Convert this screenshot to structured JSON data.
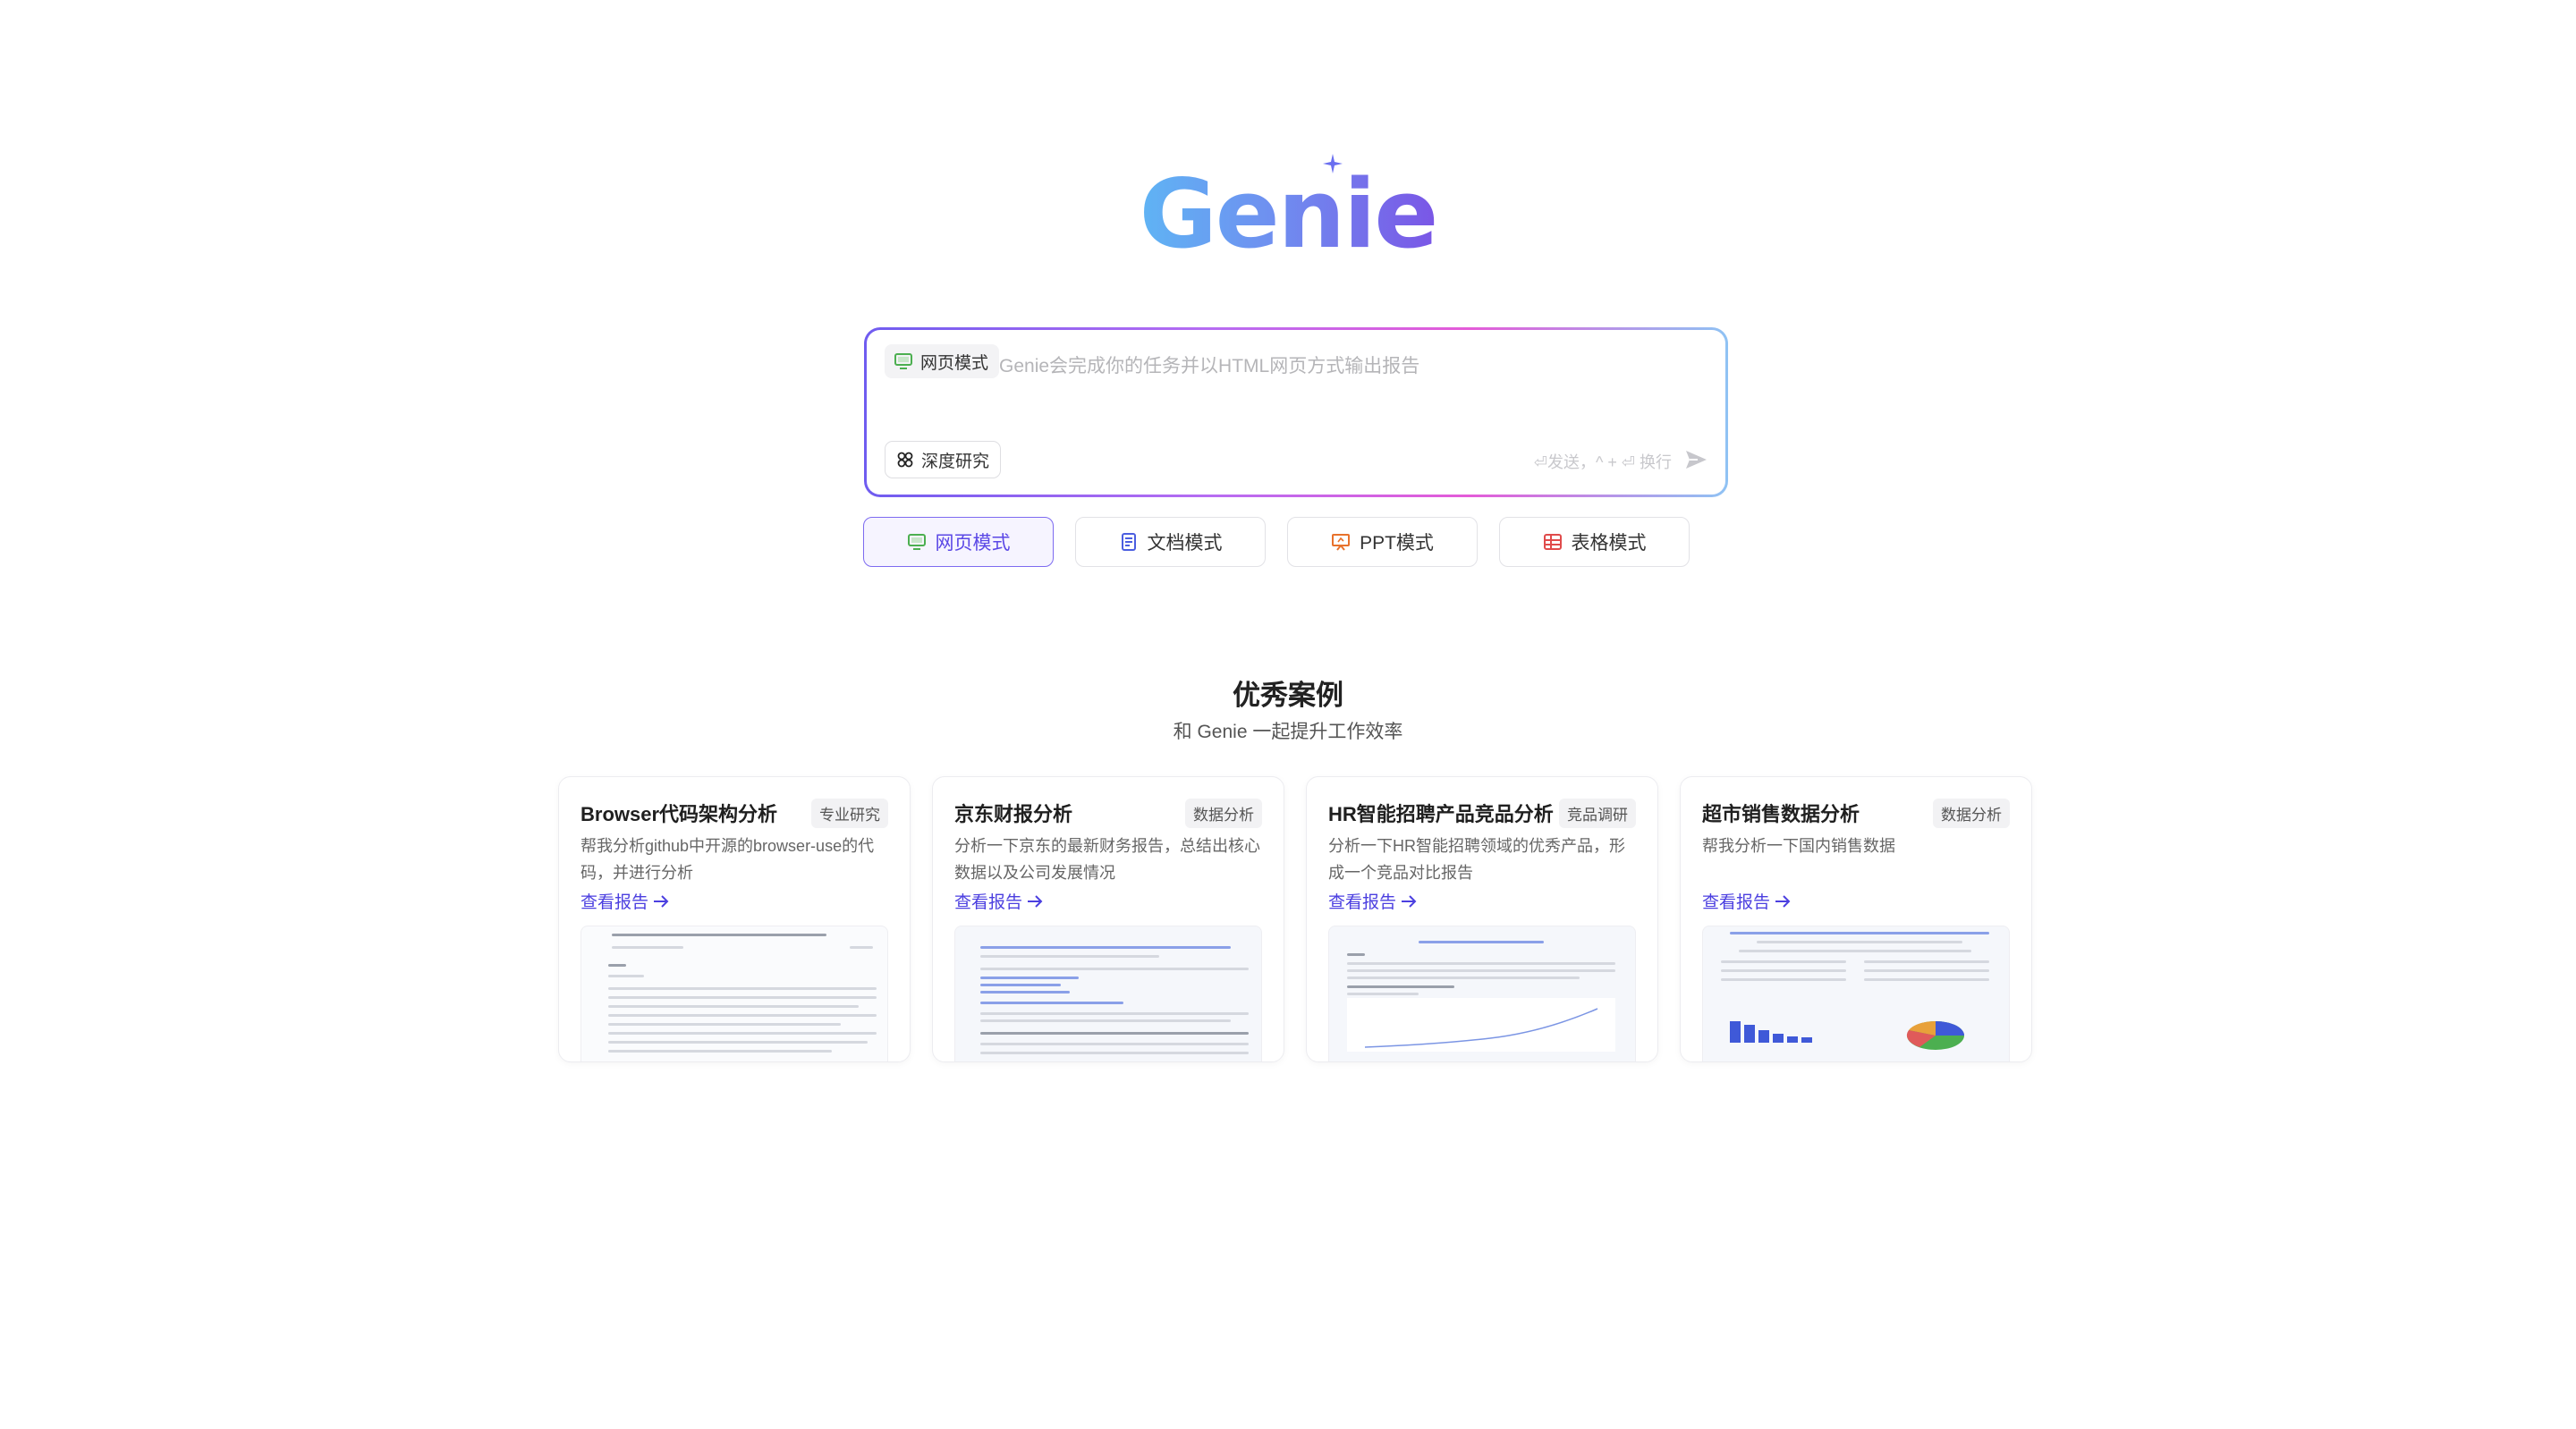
{
  "logo": {
    "text": "Genie"
  },
  "input": {
    "mode_chip_label": "网页模式",
    "placeholder": "Genie会完成你的任务并以HTML网页方式输出报告",
    "deep_research_label": "深度研究",
    "hint": "⏎发送，^ + ⏎ 换行"
  },
  "modes": [
    {
      "label": "网页模式",
      "icon": "monitor-icon",
      "color": "#4caf50"
    },
    {
      "label": "文档模式",
      "icon": "document-icon",
      "color": "#4b5ee0"
    },
    {
      "label": "PPT模式",
      "icon": "presentation-icon",
      "color": "#e8722c"
    },
    {
      "label": "表格模式",
      "icon": "table-icon",
      "color": "#e04b4b"
    }
  ],
  "showcase": {
    "title": "优秀案例",
    "subtitle": "和 Genie 一起提升工作效率",
    "link_label": "查看报告",
    "cards": [
      {
        "title": "Browser代码架构分析",
        "tag": "专业研究",
        "desc": "帮我分析github中开源的browser-use的代码，并进行分析"
      },
      {
        "title": "京东财报分析",
        "tag": "数据分析",
        "desc": "分析一下京东的最新财务报告，总结出核心数据以及公司发展情况"
      },
      {
        "title": "HR智能招聘产品竞品分析",
        "tag": "竞品调研",
        "desc": "分析一下HR智能招聘领域的优秀产品，形成一个竞品对比报告"
      },
      {
        "title": "超市销售数据分析",
        "tag": "数据分析",
        "desc": "帮我分析一下国内销售数据"
      }
    ]
  }
}
